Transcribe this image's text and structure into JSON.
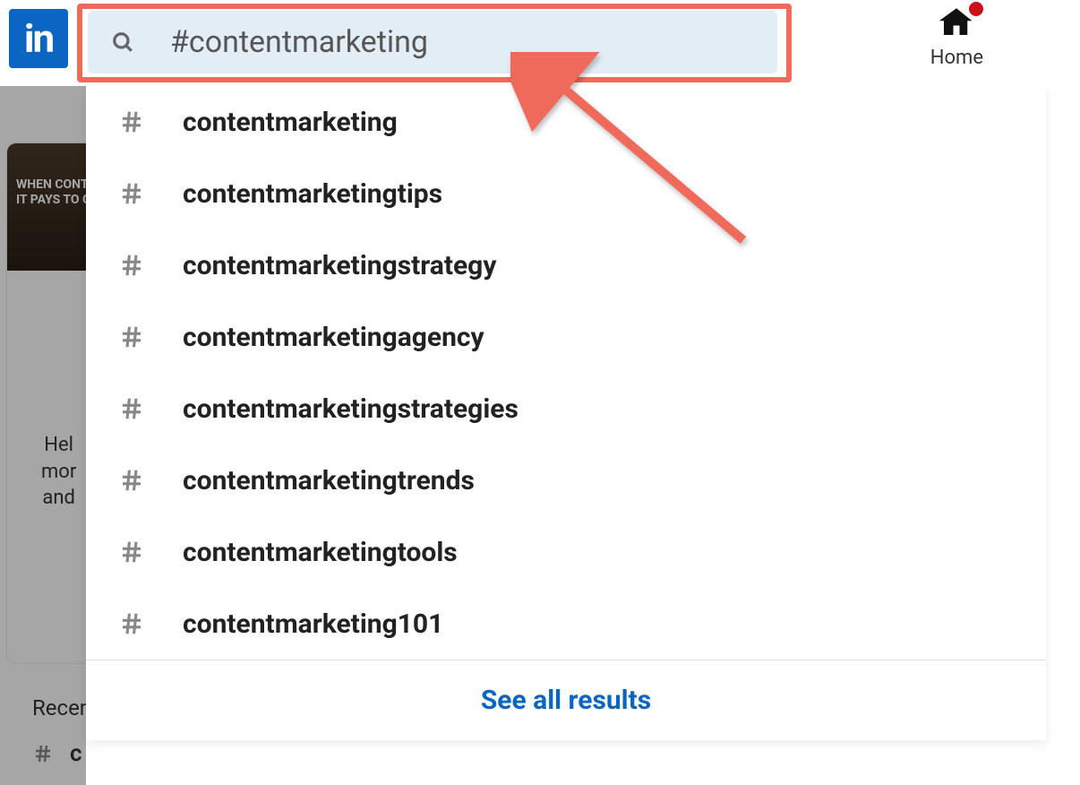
{
  "logo_text": "in",
  "search": {
    "value": "#contentmarketing",
    "placeholder": "Search"
  },
  "nav": {
    "home_label": "Home"
  },
  "suggestions": [
    "contentmarketing",
    "contentmarketingtips",
    "contentmarketingstrategy",
    "contentmarketingagency",
    "contentmarketingstrategies",
    "contentmarketingtrends",
    "contentmarketingtools",
    "contentmarketing101"
  ],
  "see_all_label": "See all results",
  "background": {
    "banner_line1": "WHEN CONTENT",
    "banner_line2": "IT PAYS TO GO D",
    "bio_line1": "Hel",
    "bio_line2": "mor",
    "bio_line3": "and",
    "recent_header": "Recen",
    "recent_item": "c"
  }
}
